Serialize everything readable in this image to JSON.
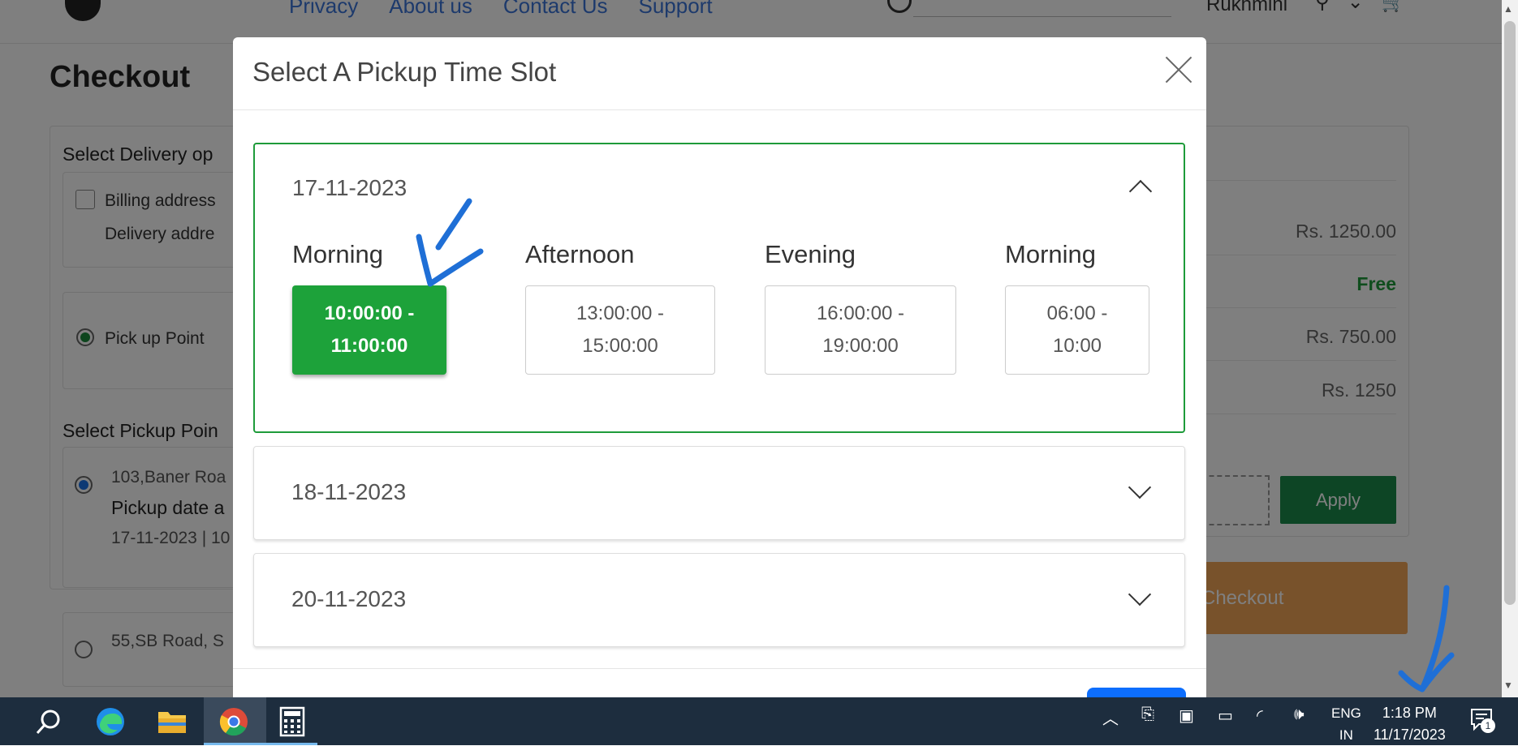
{
  "nav": {
    "links": [
      "Privacy",
      "About us",
      "Contact Us",
      "Support"
    ],
    "user_name": "Rukhmini"
  },
  "checkout": {
    "title": "Checkout",
    "delivery_heading": "Select Delivery op",
    "billing_label": "Billing address",
    "delivery_label": "Delivery addre",
    "pickup_point_label": "Pick up Point",
    "pickup_heading": "Select Pickup Poin",
    "pickup_address_1": "103,Baner Roa",
    "pickup_date_label": "Pickup date a",
    "pickup_date_value": "17-11-2023 | 10",
    "pickup_address_2": "55,SB Road, S"
  },
  "summary": {
    "subtotal": "Rs. 1250.00",
    "shipping": "Free",
    "discount": "Rs. 750.00",
    "total": "Rs. 1250",
    "apply_label": "Apply",
    "checkout_label": "Checkout"
  },
  "modal": {
    "title": "Select A Pickup Time Slot",
    "dates": [
      {
        "date": "17-11-2023",
        "expanded": true,
        "slots": [
          {
            "label": "Morning",
            "line1": "10:00:00 -",
            "line2": "11:00:00",
            "selected": true
          },
          {
            "label": "Afternoon",
            "line1": "13:00:00 -",
            "line2": "15:00:00",
            "selected": false
          },
          {
            "label": "Evening",
            "line1": "16:00:00 -",
            "line2": "19:00:00",
            "selected": false
          },
          {
            "label": "Morning",
            "line1": "06:00 -",
            "line2": "10:00",
            "selected": false
          }
        ]
      },
      {
        "date": "18-11-2023",
        "expanded": false
      },
      {
        "date": "20-11-2023",
        "expanded": false
      }
    ]
  },
  "taskbar": {
    "lang_top": "ENG",
    "lang_bottom": "IN",
    "time": "1:18 PM",
    "date": "11/17/2023",
    "notification_count": "1"
  },
  "colors": {
    "selected_slot": "#1da23a",
    "accordion_open_border": "#1e9b3a",
    "apply_button": "#1b8a4b",
    "checkout_button": "#f0a456",
    "annotation": "#1f6fd6",
    "taskbar": "#1d2d3e"
  }
}
